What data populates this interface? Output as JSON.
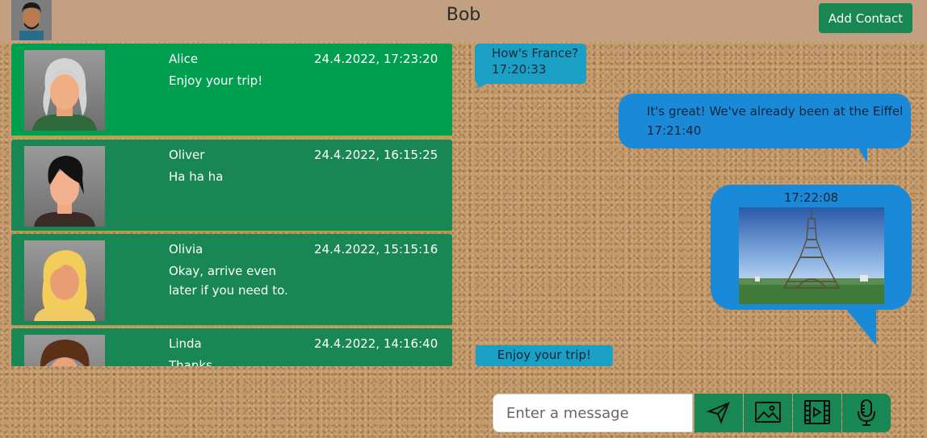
{
  "header": {
    "title": "Bob",
    "add_contact_label": "Add Contact",
    "avatar_icon": "user-avatar-icon"
  },
  "contacts": [
    {
      "name": "Alice",
      "time": "24.4.2022, 17:23:20",
      "last_message": "Enjoy your trip!",
      "active": true
    },
    {
      "name": "Oliver",
      "time": "24.4.2022, 16:15:25",
      "last_message": "Ha ha ha",
      "active": false
    },
    {
      "name": "Olivia",
      "time": "24.4.2022, 15:15:16",
      "last_message": "Okay, arrive even later if you need to.",
      "active": false
    },
    {
      "name": "Linda",
      "time": "24.4.2022, 14:16:40",
      "last_message": "Thanks.",
      "active": false
    }
  ],
  "messages": [
    {
      "text": "How's France?",
      "time": "17:20:33",
      "direction": "incoming"
    },
    {
      "text": "It's great! We've already been at the Eiffel",
      "time": "17:21:40",
      "direction": "outgoing"
    },
    {
      "text": "",
      "time": "17:22:08",
      "direction": "outgoing",
      "media": "eiffel-tower-photo"
    },
    {
      "text": "Enjoy your trip!",
      "time": "",
      "direction": "incoming"
    }
  ],
  "composer": {
    "placeholder": "Enter a message",
    "value": "",
    "buttons": [
      "send-icon",
      "image-icon",
      "video-icon",
      "microphone-icon"
    ]
  },
  "colors": {
    "header_bg": "#c3a082",
    "contact_bg": "#198754",
    "contact_active_bg": "#009f4f",
    "incoming_bubble": "#1aa0c4",
    "outgoing_bubble": "#1a8ad8",
    "button_green": "#198754"
  }
}
